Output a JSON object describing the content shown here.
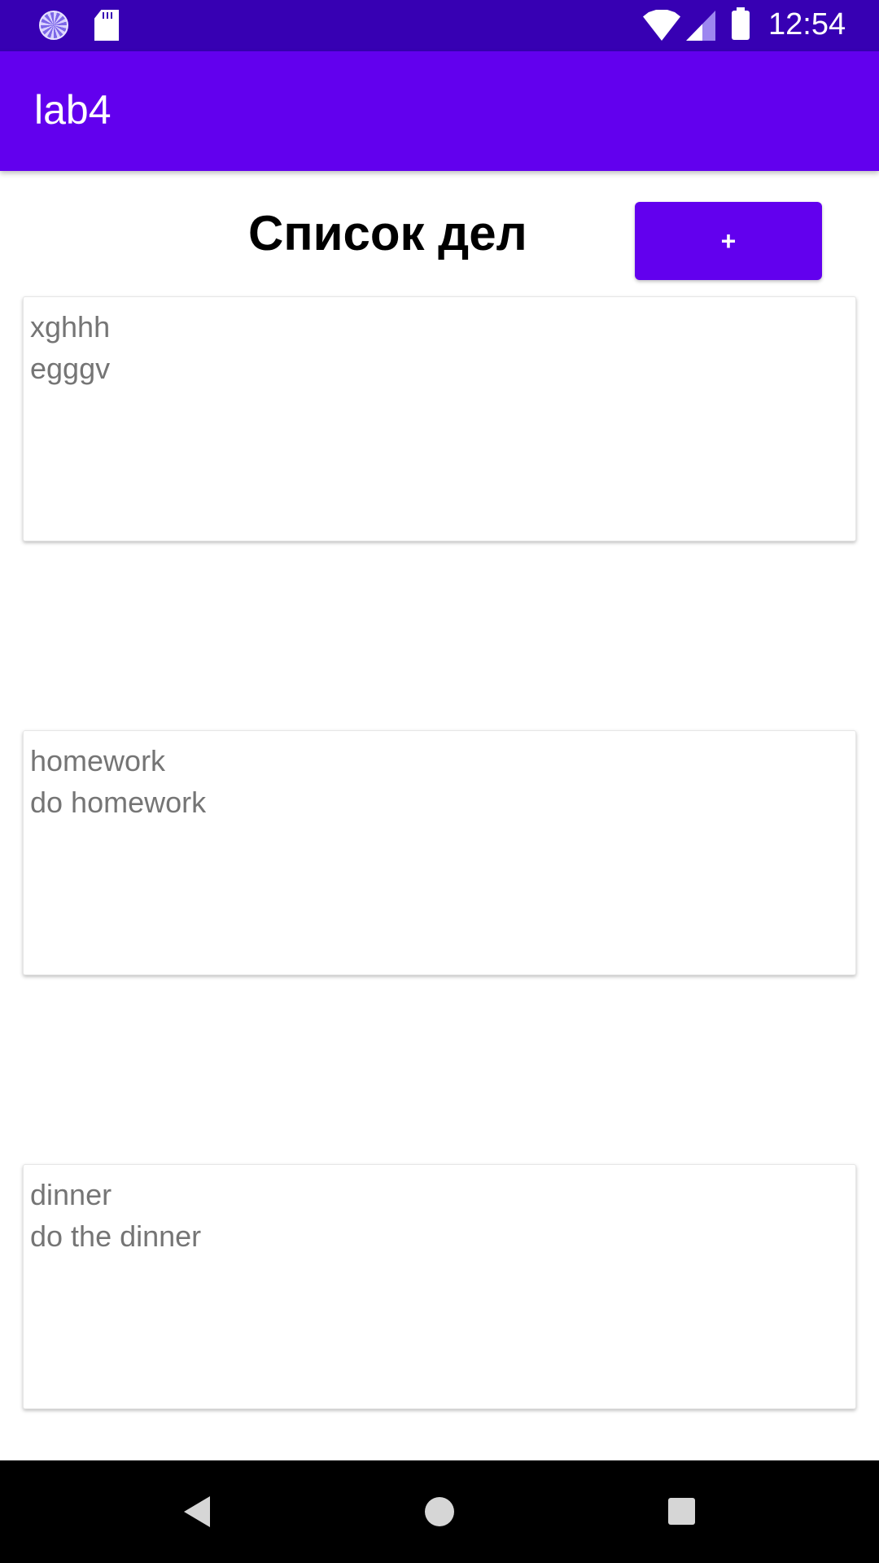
{
  "status_bar": {
    "time": "12:54",
    "icons": [
      "loading-spinner-icon",
      "sd-card-icon",
      "wifi-icon",
      "cell-signal-icon",
      "battery-icon"
    ]
  },
  "app_bar": {
    "title": "lab4"
  },
  "main": {
    "heading": "Список дел",
    "add_button_label": "+",
    "tasks": [
      {
        "title": "xghhh",
        "description": "egggv"
      },
      {
        "title": "homework",
        "description": "do homework"
      },
      {
        "title": "dinner",
        "description": "do the dinner"
      }
    ]
  },
  "nav_bar": {
    "icons": [
      "back-icon",
      "home-icon",
      "recents-icon"
    ]
  },
  "colors": {
    "status_bar": "#3700B3",
    "primary": "#6200EE",
    "card_text": "#757575",
    "nav_bar": "#000000"
  }
}
